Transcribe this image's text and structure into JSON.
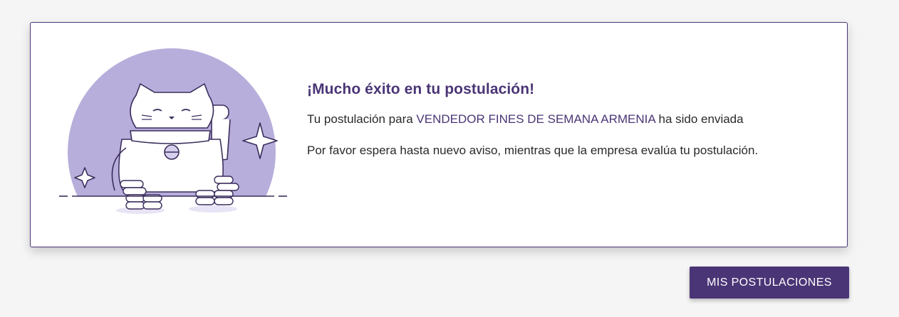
{
  "message": {
    "title": "¡Mucho éxito en tu postulación!",
    "sent_prefix": "Tu postulación para ",
    "job_title": "VENDEDOR FINES DE SEMANA ARMENIA",
    "sent_suffix": " ha sido enviada",
    "wait_text": "Por favor espera hasta nuevo aviso, mientras que la empresa evalúa tu postulación."
  },
  "actions": {
    "my_applications_label": "MIS POSTULACIONES"
  },
  "illustration": {
    "icon": "lucky-cat-illustration",
    "circle_color": "#b8aedb",
    "stroke_color": "#3a2d5c"
  },
  "colors": {
    "brand": "#4a3576",
    "background": "#f5f5f5",
    "card": "#ffffff"
  }
}
